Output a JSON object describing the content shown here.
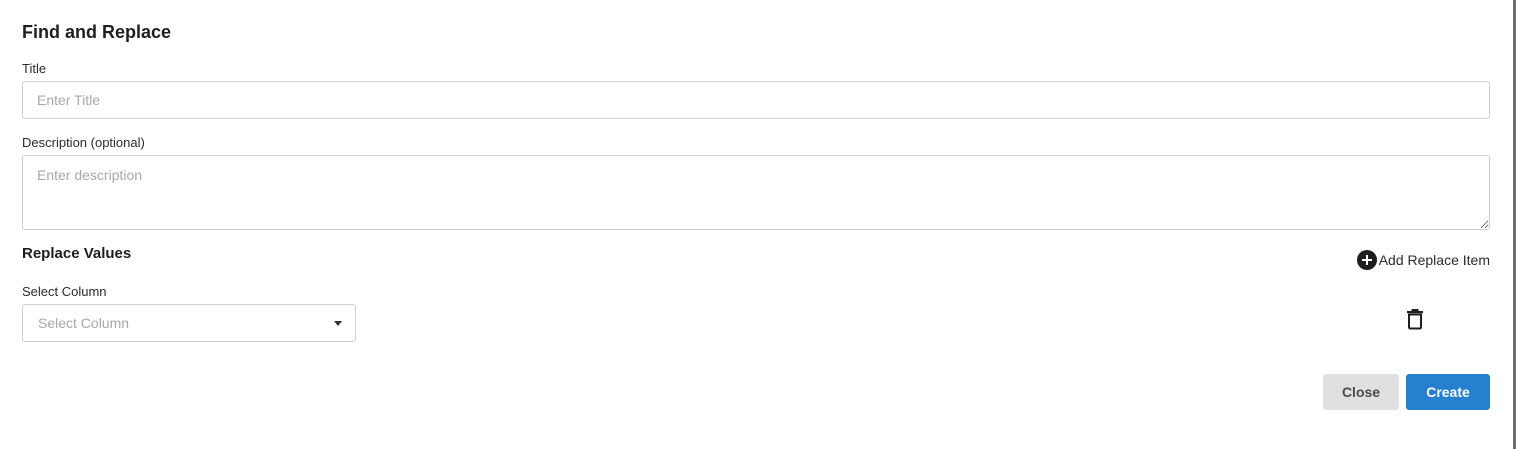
{
  "dialog": {
    "title": "Find and Replace"
  },
  "fields": {
    "title_label": "Title",
    "title_placeholder": "Enter Title",
    "description_label": "Description (optional)",
    "description_placeholder": "Enter description"
  },
  "replace": {
    "section_title": "Replace Values",
    "add_label": "Add Replace Item",
    "add_icon": "plus-circle-icon",
    "column_label": "Select Column",
    "column_placeholder": "Select Column",
    "delete_icon": "trash-icon"
  },
  "actions": {
    "close_label": "Close",
    "create_label": "Create"
  },
  "colors": {
    "primary": "#2680cf",
    "secondary": "#e0e0e0"
  }
}
